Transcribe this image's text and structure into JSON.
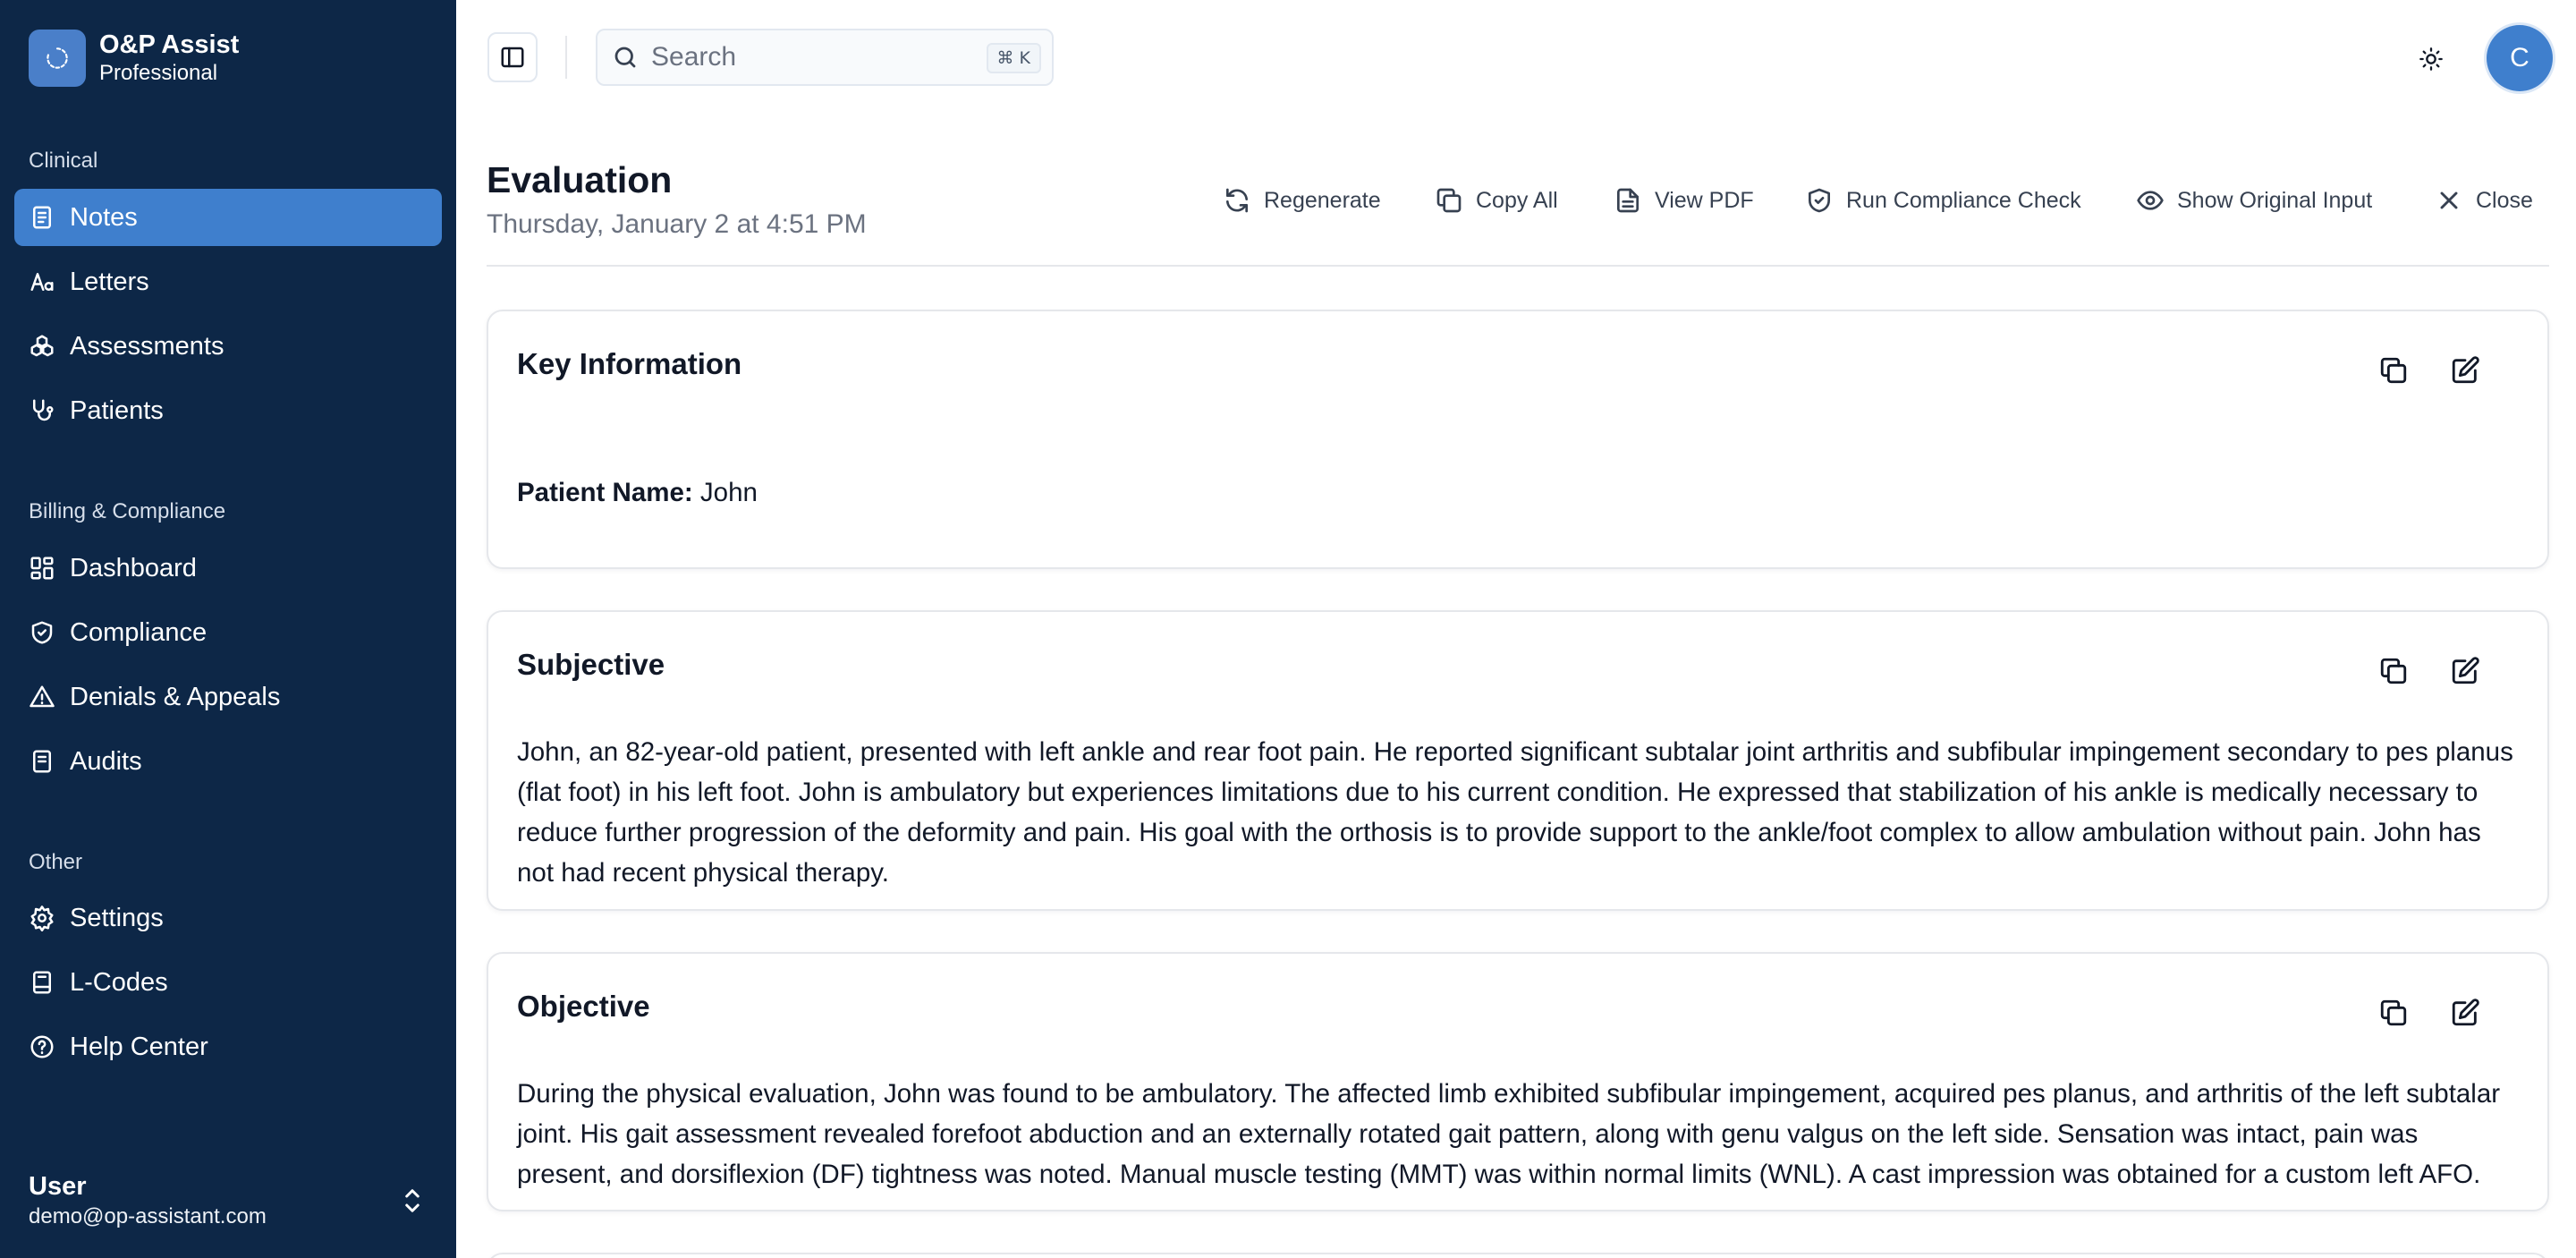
{
  "app": {
    "name": "O&P Assist",
    "plan": "Professional"
  },
  "sidebar": {
    "sections": [
      {
        "label": "Clinical"
      },
      {
        "label": "Billing & Compliance"
      },
      {
        "label": "Other"
      }
    ],
    "items": [
      {
        "label": "Notes",
        "icon": "notes-icon",
        "active": true
      },
      {
        "label": "Letters",
        "icon": "letters-icon"
      },
      {
        "label": "Assessments",
        "icon": "assessments-icon"
      },
      {
        "label": "Patients",
        "icon": "patients-icon"
      },
      {
        "label": "Dashboard",
        "icon": "dashboard-icon"
      },
      {
        "label": "Compliance",
        "icon": "compliance-icon"
      },
      {
        "label": "Denials & Appeals",
        "icon": "warning-icon"
      },
      {
        "label": "Audits",
        "icon": "audits-icon"
      },
      {
        "label": "Settings",
        "icon": "gear-icon"
      },
      {
        "label": "L-Codes",
        "icon": "book-icon"
      },
      {
        "label": "Help Center",
        "icon": "help-icon"
      }
    ],
    "user": {
      "name": "User",
      "email": "demo@op-assistant.com"
    }
  },
  "topbar": {
    "search_placeholder": "Search",
    "search_shortcut": "⌘ K",
    "avatar_initial": "C"
  },
  "page": {
    "title": "Evaluation",
    "date": "Thursday, January 2 at 4:51 PM",
    "actions": [
      {
        "label": "Regenerate",
        "icon": "refresh-icon"
      },
      {
        "label": "Copy All",
        "icon": "copy-icon"
      },
      {
        "label": "View PDF",
        "icon": "file-icon"
      },
      {
        "label": "Run Compliance Check",
        "icon": "shield-icon"
      },
      {
        "label": "Show Original Input",
        "icon": "eye-icon"
      },
      {
        "label": "Close",
        "icon": "close-icon"
      }
    ]
  },
  "sections": {
    "key_info": {
      "title": "Key Information",
      "patient_label": "Patient Name:",
      "patient_value": " John"
    },
    "subjective": {
      "title": "Subjective",
      "text": "John, an 82-year-old patient, presented with left ankle and rear foot pain. He reported significant subtalar joint arthritis and subfibular impingement secondary to pes planus (flat foot) in his left foot. John is ambulatory but experiences limitations due to his current condition. He expressed that stabilization of his ankle is medically necessary to reduce further progression of the deformity and pain. His goal with the orthosis is to provide support to the ankle/foot complex to allow ambulation without pain. John has not had recent physical therapy."
    },
    "objective": {
      "title": "Objective",
      "text": "During the physical evaluation, John was found to be ambulatory. The affected limb exhibited subfibular impingement, acquired pes planus, and arthritis of the left subtalar joint. His gait assessment revealed forefoot abduction and an externally rotated gait pattern, along with genu valgus on the left side. Sensation was intact, pain was present, and dorsiflexion (DF) tightness was noted. Manual muscle testing (MMT) was within normal limits (WNL). A cast impression was obtained for a custom left AFO."
    }
  }
}
